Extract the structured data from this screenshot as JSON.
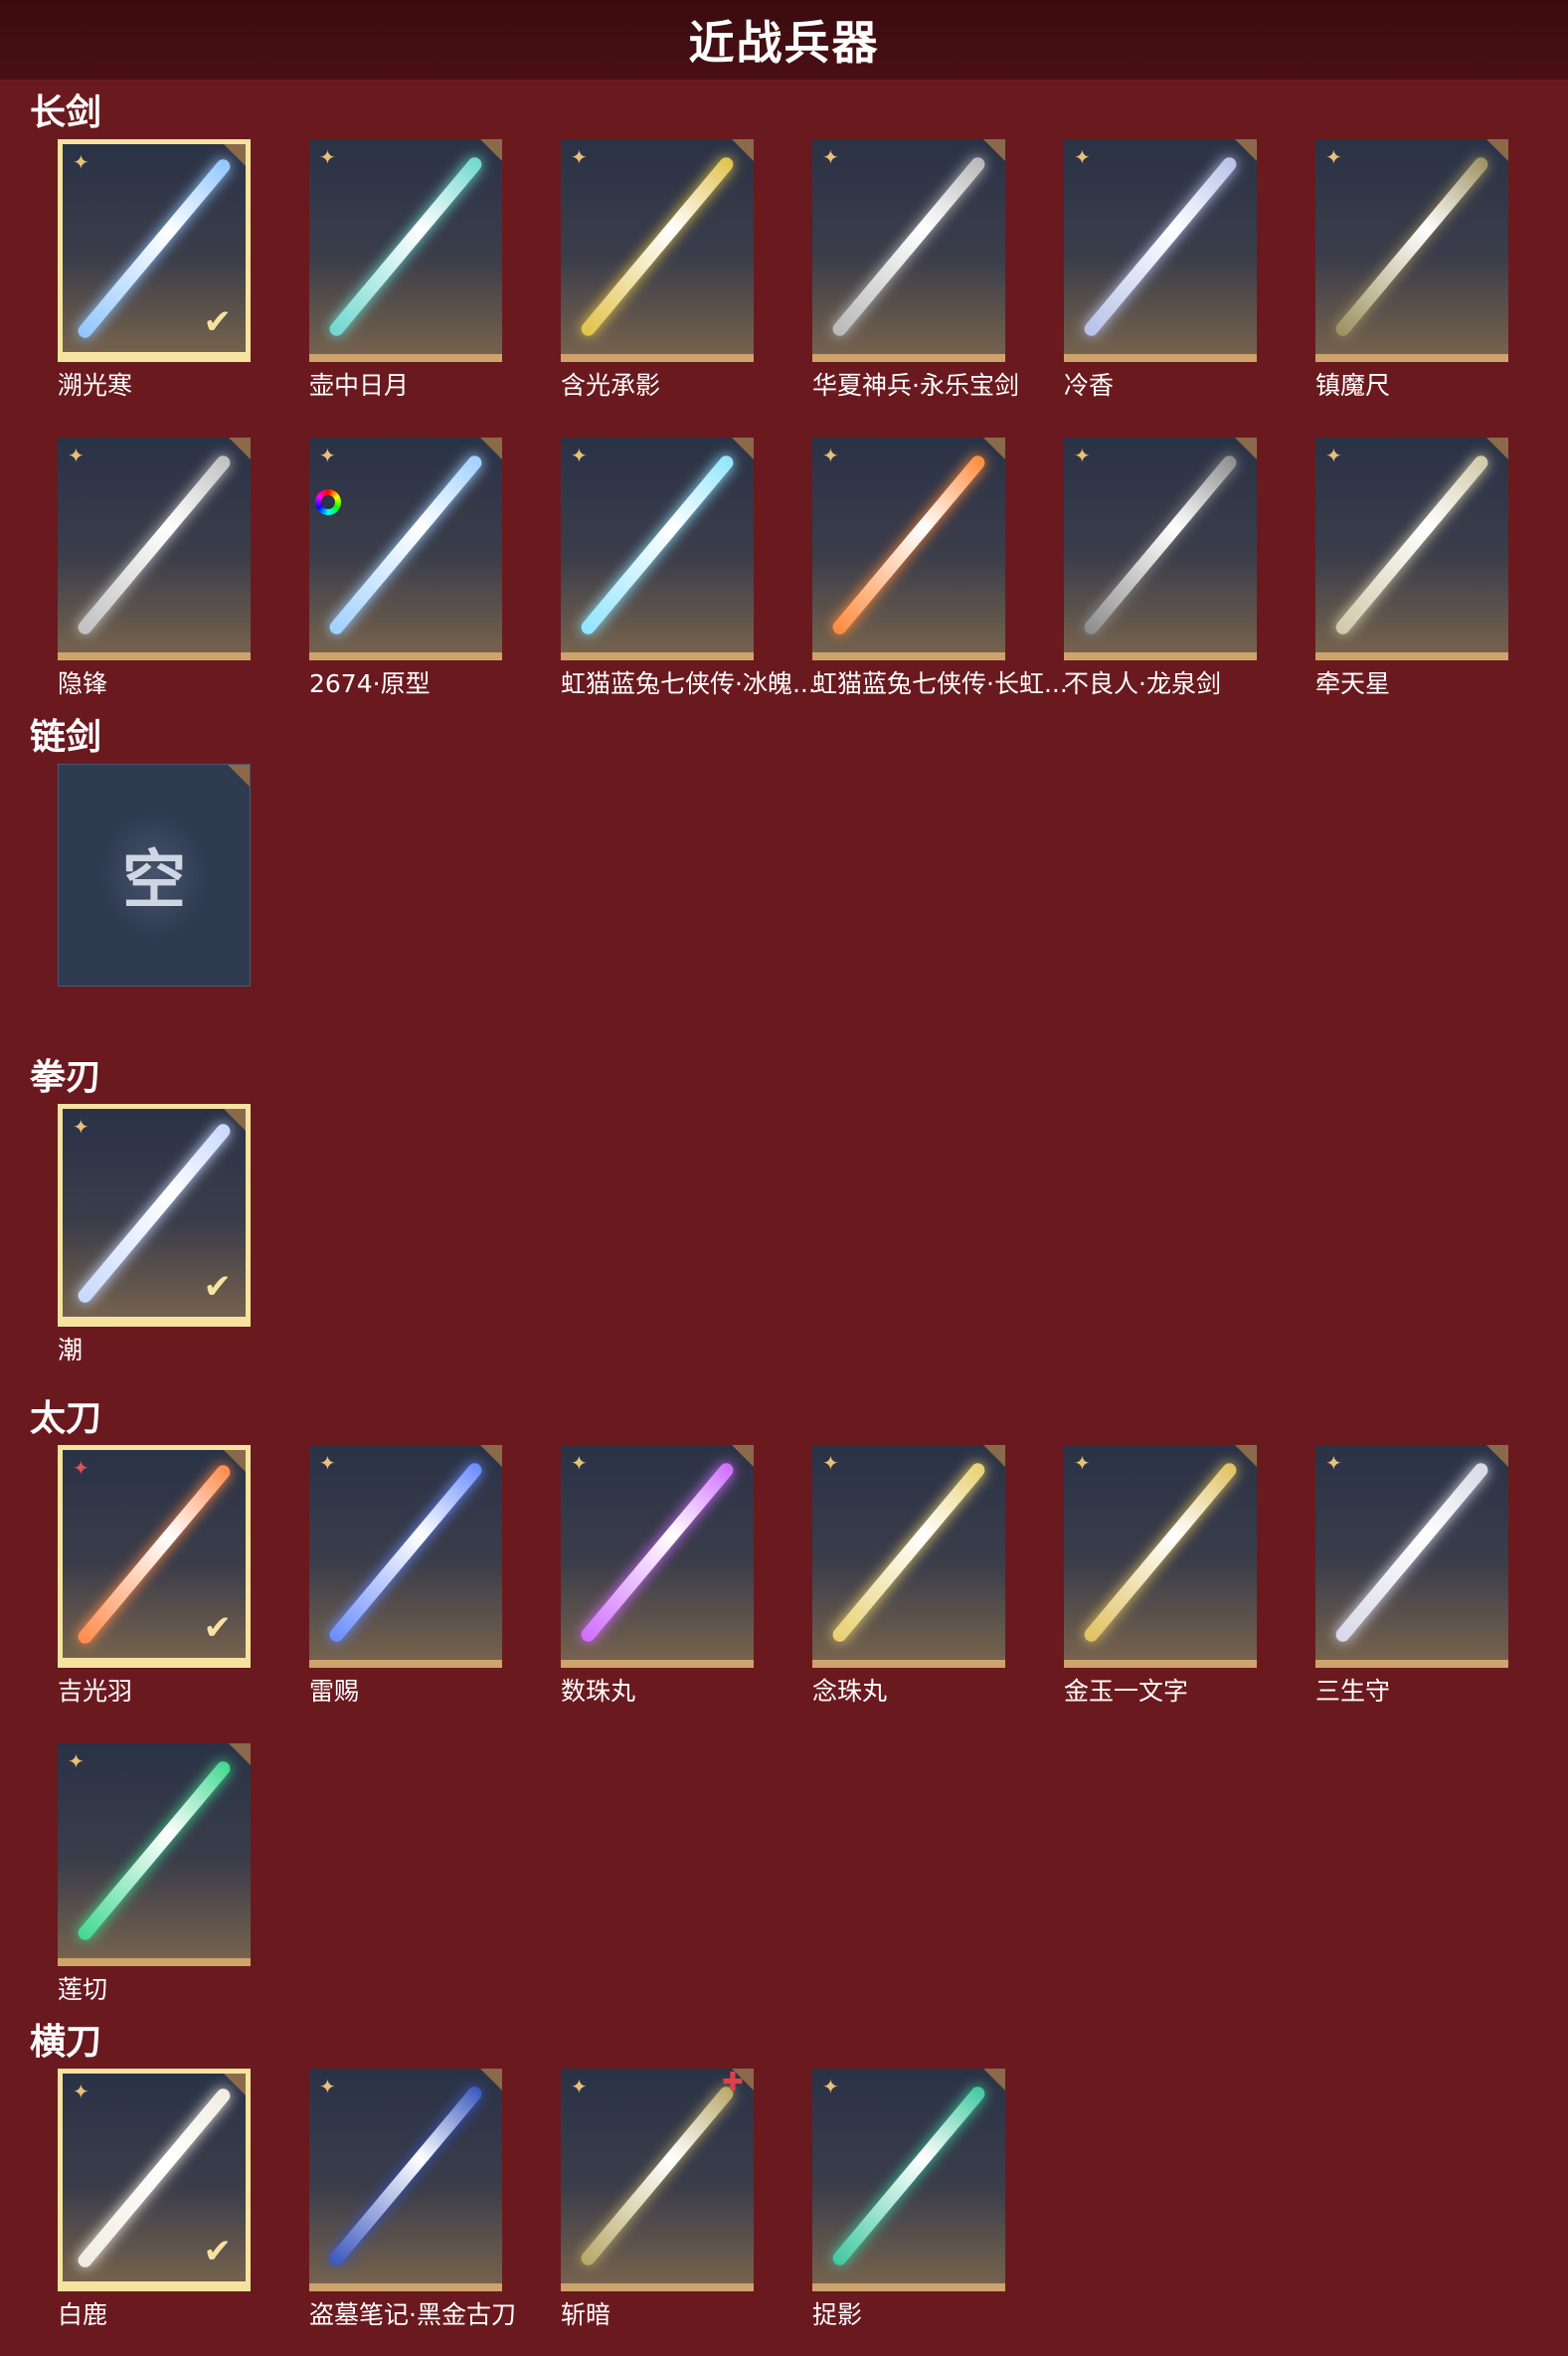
{
  "title": "近战兵器",
  "sections": [
    {
      "name": "长剑",
      "items": [
        {
          "name": "溯光寒",
          "selected": true,
          "color": "#8fc6ff"
        },
        {
          "name": "壶中日月",
          "selected": false,
          "color": "#6fd8cf"
        },
        {
          "name": "含光承影",
          "selected": false,
          "color": "#e1c24b"
        },
        {
          "name": "华夏神兵·永乐宝剑",
          "selected": false,
          "color": "#b8b8b8"
        },
        {
          "name": "冷香",
          "selected": false,
          "color": "#b7c1e8"
        },
        {
          "name": "镇魔尺",
          "selected": false,
          "color": "#9c9060"
        },
        {
          "name": "隐锋",
          "selected": false,
          "color": "#c0c0c0"
        },
        {
          "name": "2674·原型",
          "selected": false,
          "color": "#9fd0ff"
        },
        {
          "name": "虹猫蓝兔七侠传·冰魄...",
          "selected": false,
          "color": "#8fe4ff"
        },
        {
          "name": "虹猫蓝兔七侠传·长虹...",
          "selected": false,
          "color": "#ff8a3c"
        },
        {
          "name": "不良人·龙泉剑",
          "selected": false,
          "color": "#8c8c8c"
        },
        {
          "name": "牵天星",
          "selected": false,
          "color": "#d0c8a8"
        }
      ]
    },
    {
      "name": "链剑",
      "items": [
        {
          "name": "",
          "empty": true,
          "empty_label": "空"
        }
      ]
    },
    {
      "name": "拳刃",
      "items": [
        {
          "name": "潮",
          "selected": true,
          "color": "#c8d8ff"
        }
      ]
    },
    {
      "name": "太刀",
      "items": [
        {
          "name": "吉光羽",
          "selected": true,
          "color": "#ff8a4a"
        },
        {
          "name": "雷赐",
          "selected": false,
          "color": "#6a8cff"
        },
        {
          "name": "数珠丸",
          "selected": false,
          "color": "#d06cff"
        },
        {
          "name": "念珠丸",
          "selected": false,
          "color": "#e8d070"
        },
        {
          "name": "金玉一文字",
          "selected": false,
          "color": "#e0c060"
        },
        {
          "name": "三生守",
          "selected": false,
          "color": "#d8d8e8"
        },
        {
          "name": "莲切",
          "selected": false,
          "color": "#40d890"
        }
      ]
    },
    {
      "name": "横刀",
      "items": [
        {
          "name": "白鹿",
          "selected": true,
          "color": "#f0ece0"
        },
        {
          "name": "盗墓笔记·黑金古刀",
          "selected": false,
          "color": "#3a58c0"
        },
        {
          "name": "斩暗",
          "selected": false,
          "color": "#b8a868"
        },
        {
          "name": "捉影",
          "selected": false,
          "color": "#40c8a0"
        }
      ]
    }
  ]
}
